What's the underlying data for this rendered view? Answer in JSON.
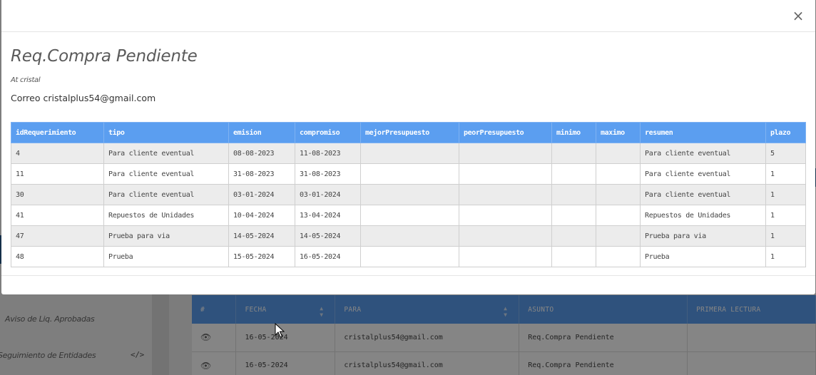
{
  "background": {
    "sidebar": {
      "items": [
        {
          "label": "Aviso de Liq. Aprobadas"
        },
        {
          "label": "Seguimiento de Entidades",
          "icon": "code-icon",
          "icon_glyph": "</>"
        }
      ]
    },
    "messages_table": {
      "columns": [
        "#",
        "FECHA",
        "PARA",
        "ASUNTO",
        "PRIMERA LECTURA"
      ],
      "rows": [
        {
          "icon": "eye-icon",
          "fecha": "16-05-2024",
          "para": "cristalplus54@gmail.com",
          "asunto": "Req.Compra Pendiente",
          "primera_lectura": ""
        },
        {
          "icon": "eye-icon",
          "fecha": "16-05-2024",
          "para": "cristalplus54@gmail.com",
          "asunto": "Req.Compra Pendiente",
          "primera_lectura": ""
        }
      ]
    }
  },
  "modal": {
    "close_glyph": "×",
    "title": "Req.Compra Pendiente",
    "subtitle": "At cristal",
    "email_line": "Correo cristalplus54@gmail.com",
    "table": {
      "columns": [
        "idRequerimiento",
        "tipo",
        "emision",
        "compromiso",
        "mejorPresupuesto",
        "peorPresupuesto",
        "minimo",
        "maximo",
        "resumen",
        "plazo"
      ],
      "rows": [
        [
          "4",
          "Para cliente eventual",
          "08-08-2023",
          "11-08-2023",
          "",
          "",
          "",
          "",
          "Para cliente eventual",
          "5"
        ],
        [
          "11",
          "Para cliente eventual",
          "31-08-2023",
          "31-08-2023",
          "",
          "",
          "",
          "",
          "Para cliente eventual",
          "1"
        ],
        [
          "30",
          "Para cliente eventual",
          "03-01-2024",
          "03-01-2024",
          "",
          "",
          "",
          "",
          "Para cliente eventual",
          "1"
        ],
        [
          "41",
          "Repuestos de Unidades",
          "10-04-2024",
          "13-04-2024",
          "",
          "",
          "",
          "",
          "Repuestos de Unidades",
          "1"
        ],
        [
          "47",
          "Prueba para via",
          "14-05-2024",
          "14-05-2024",
          "",
          "",
          "",
          "",
          "Prueba para via",
          "1"
        ],
        [
          "48",
          "Prueba",
          "15-05-2024",
          "16-05-2024",
          "",
          "",
          "",
          "",
          "Prueba",
          "1"
        ]
      ]
    }
  },
  "colors": {
    "header_blue": "#5b9ef0",
    "row_stripe": "#ececec",
    "topbar": "#2a5a8c"
  }
}
